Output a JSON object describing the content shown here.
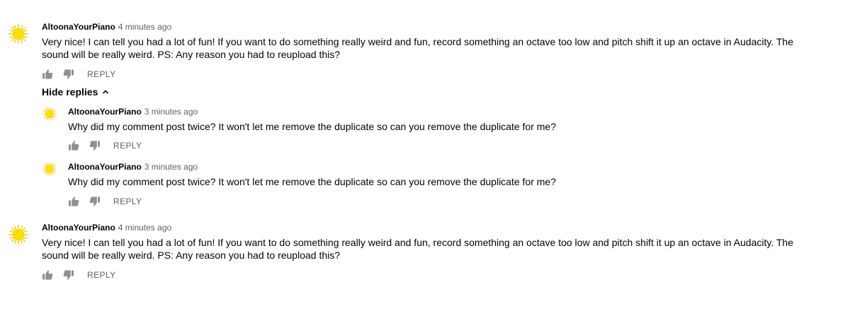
{
  "colors": {
    "avatar_sun": "#f8e000",
    "avatar_ray": "#f4c400",
    "meta_text": "#606060"
  },
  "comments": [
    {
      "author": "AltoonaYourPiano",
      "time": "4 minutes ago",
      "text": "Very nice! I can tell you had a lot of fun! If you want to do something really weird and fun, record something an octave too low and pitch shift it up an octave in Audacity. The sound will be really weird. PS: Any reason you had to reupload this?",
      "reply_label": "REPLY"
    },
    {
      "author": "AltoonaYourPiano",
      "time": "4 minutes ago",
      "text": "Very nice! I can tell you had a lot of fun! If you want to do something really weird and fun, record something an octave too low and pitch shift it up an octave in Audacity. The sound will be really weird. PS: Any reason you had to reupload this?",
      "reply_label": "REPLY"
    }
  ],
  "hide_replies_label": "Hide replies",
  "replies": [
    {
      "author": "AltoonaYourPiano",
      "time": "3 minutes ago",
      "text": "Why did my comment post twice? It won't let me remove the duplicate so can you remove the duplicate for me?",
      "reply_label": "REPLY"
    },
    {
      "author": "AltoonaYourPiano",
      "time": "3 minutes ago",
      "text": "Why did my comment post twice? It won't let me remove the duplicate so can you remove the duplicate for me?",
      "reply_label": "REPLY"
    }
  ],
  "icons": {
    "avatar": "sun-avatar-icon",
    "like": "thumbs-up-icon",
    "dislike": "thumbs-down-icon",
    "toggle": "chevron-up-icon"
  }
}
